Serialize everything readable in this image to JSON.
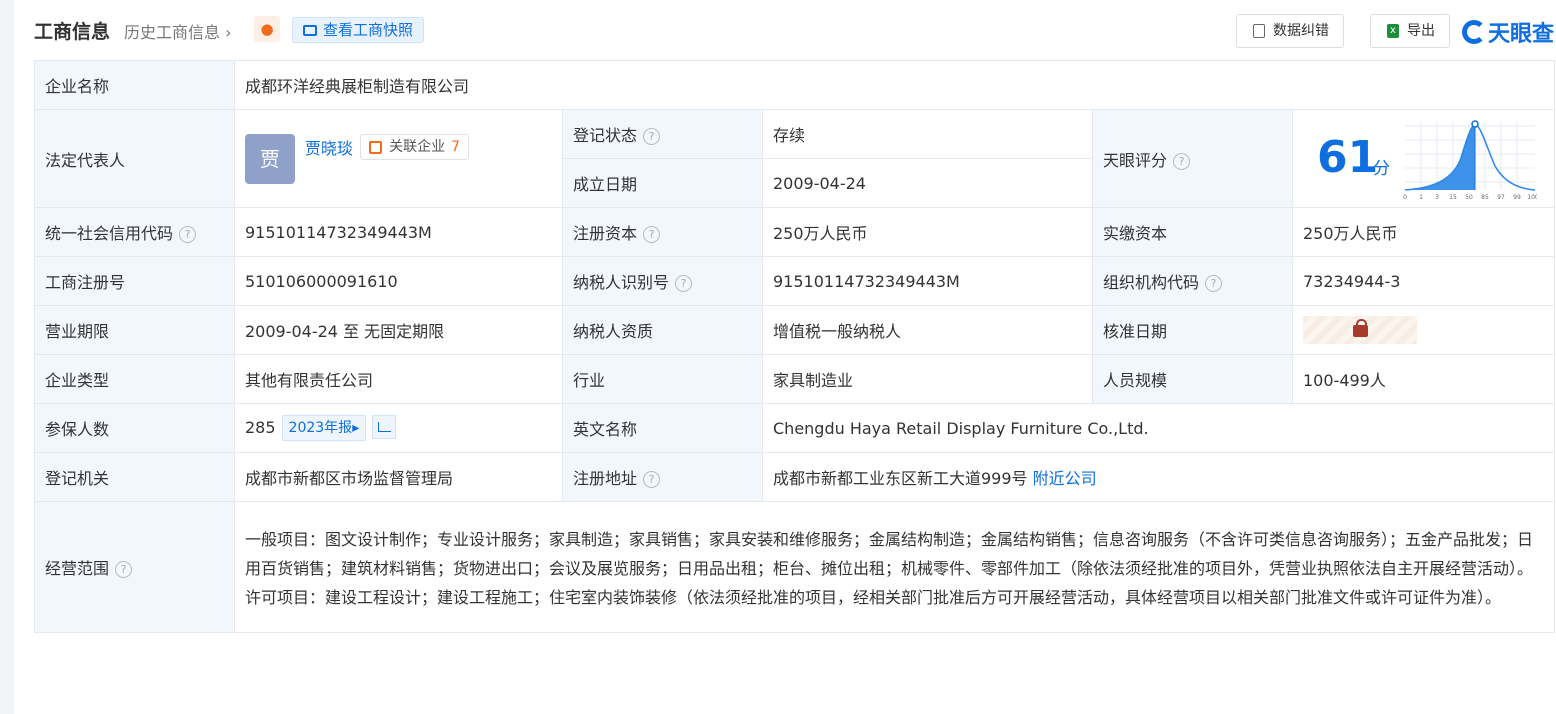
{
  "header": {
    "title": "工商信息",
    "history_link": "历史工商信息",
    "snapshot_button": "查看工商快照",
    "correct_button": "数据纠错",
    "export_button": "导出",
    "brand": "天眼查"
  },
  "company": {
    "name_label": "企业名称",
    "name": "成都环洋经典展柜制造有限公司",
    "legal_rep_label": "法定代表人",
    "legal_rep_avatar": "贾",
    "legal_rep": "贾晓琰",
    "assoc_label": "关联企业",
    "assoc_count": "7",
    "reg_status_label": "登记状态",
    "reg_status": "存续",
    "founded_label": "成立日期",
    "founded": "2009-04-24",
    "score_label": "天眼评分",
    "score": "61",
    "score_unit": "分",
    "score_axis": [
      "0",
      "1",
      "3",
      "15",
      "50",
      "85",
      "97",
      "99",
      "100"
    ],
    "credit_code_label": "统一社会信用代码",
    "credit_code": "91510114732349443M",
    "reg_capital_label": "注册资本",
    "reg_capital": "250万人民币",
    "paid_capital_label": "实缴资本",
    "paid_capital": "250万人民币",
    "biz_reg_no_label": "工商注册号",
    "biz_reg_no": "510106000091610",
    "taxpayer_id_label": "纳税人识别号",
    "taxpayer_id": "91510114732349443M",
    "org_code_label": "组织机构代码",
    "org_code": "73234944-3",
    "term_label": "营业期限",
    "term": "2009-04-24 至 无固定期限",
    "tax_qual_label": "纳税人资质",
    "tax_qual": "增值税一般纳税人",
    "approval_date_label": "核准日期",
    "type_label": "企业类型",
    "type": "其他有限责任公司",
    "industry_label": "行业",
    "industry": "家具制造业",
    "staff_label": "人员规模",
    "staff": "100-499人",
    "insured_label": "参保人数",
    "insured": "285",
    "insured_year": "2023年报",
    "english_name_label": "英文名称",
    "english_name": "Chengdu Haya Retail Display Furniture Co.,Ltd.",
    "authority_label": "登记机关",
    "authority": "成都市新都区市场监督管理局",
    "address_label": "注册地址",
    "address": "成都市新都工业东区新工大道999号",
    "nearby_link": "附近公司",
    "scope_label": "经营范围",
    "scope": "一般项目：图文设计制作；专业设计服务；家具制造；家具销售；家具安装和维修服务；金属结构制造；金属结构销售；信息咨询服务（不含许可类信息咨询服务）；五金产品批发；日用百货销售；建筑材料销售；货物进出口；会议及展览服务；日用品出租；柜台、摊位出租；机械零件、零部件加工（除依法须经批准的项目外，凭营业执照依法自主开展经营活动）。许可项目：建设工程设计；建设工程施工；住宅室内装饰装修（依法须经批准的项目，经相关部门批准后方可开展经营活动，具体经营项目以相关部门批准文件或许可证件为准）。"
  }
}
